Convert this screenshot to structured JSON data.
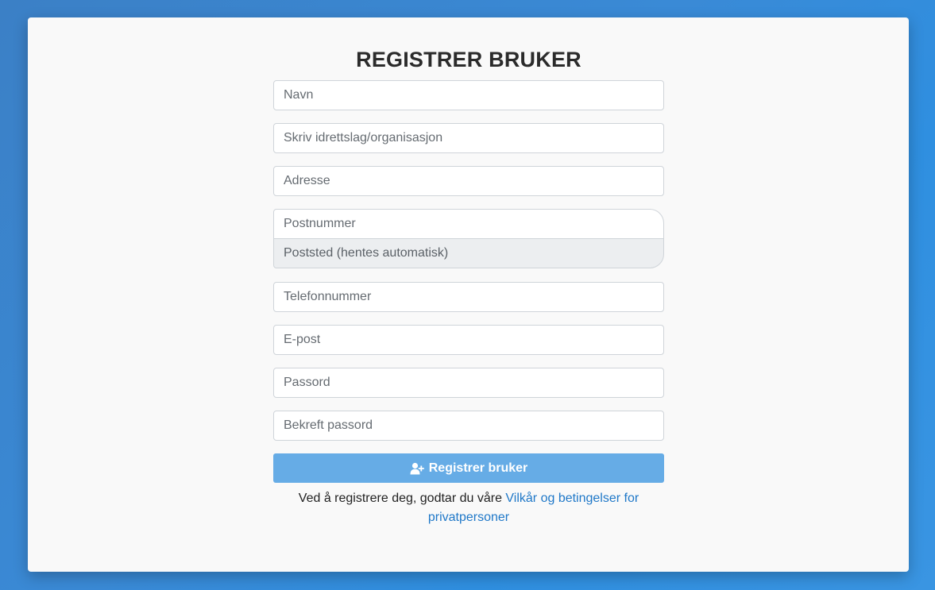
{
  "form": {
    "title": "REGISTRER BRUKER",
    "fields": {
      "name_placeholder": "Navn",
      "organization_placeholder": "Skriv idrettslag/organisasjon",
      "address_placeholder": "Adresse",
      "postal_code_placeholder": "Postnummer",
      "city_placeholder": "Poststed (hentes automatisk)",
      "phone_placeholder": "Telefonnummer",
      "email_placeholder": "E-post",
      "password_placeholder": "Passord",
      "confirm_password_placeholder": "Bekreft passord"
    },
    "submit_label": "Registrer bruker",
    "submit_icon": "user-plus-icon",
    "terms_text": "Ved å registrere deg, godtar du våre ",
    "terms_link": "Vilkår og betingelser for privatpersoner"
  },
  "colors": {
    "background": "#3a8ad6",
    "card": "#f9f9f9",
    "button": "#66ace6",
    "link": "#1f78c8"
  }
}
